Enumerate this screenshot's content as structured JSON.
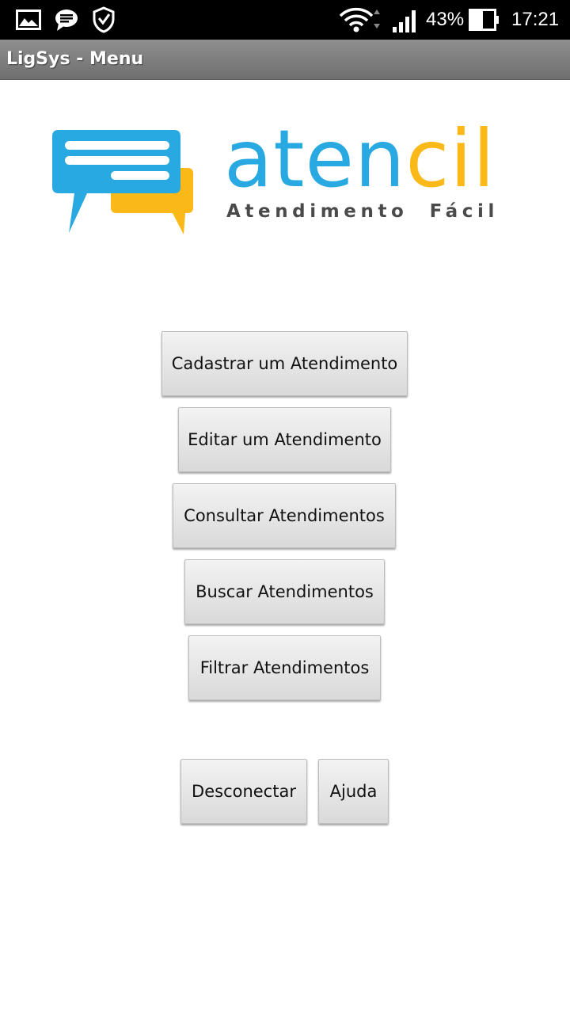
{
  "status_bar": {
    "battery_percent": "43%",
    "time": "17:21",
    "icons": [
      "image-icon",
      "message-icon",
      "shield-icon",
      "wifi-icon",
      "signal-icon",
      "battery-icon"
    ]
  },
  "title_bar": {
    "title": "LigSys - Menu"
  },
  "logo": {
    "word_part1": "aten",
    "word_part2": "cil",
    "tagline": "Atendimento  Fácil",
    "colors": {
      "blue": "#29a9e1",
      "yellow": "#fbb919"
    }
  },
  "menu": {
    "cadastrar": "Cadastrar um Atendimento",
    "editar": "Editar um Atendimento",
    "consultar": "Consultar Atendimentos",
    "buscar": "Buscar Atendimentos",
    "filtrar": "Filtrar Atendimentos",
    "desconectar": "Desconectar",
    "ajuda": "Ajuda"
  }
}
